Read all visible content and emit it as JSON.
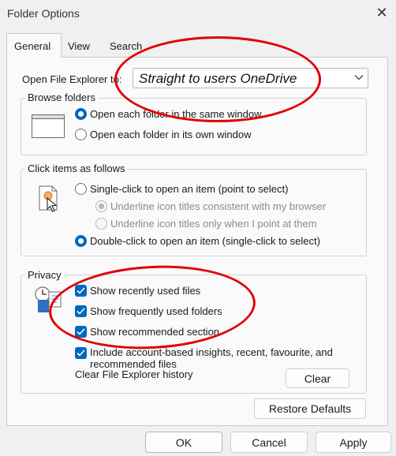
{
  "window": {
    "title": "Folder Options",
    "close_icon": "close-icon"
  },
  "tabs": [
    {
      "label": "General",
      "selected": true
    },
    {
      "label": "View",
      "selected": false
    },
    {
      "label": "Search",
      "selected": false
    }
  ],
  "open_file_explorer": {
    "label": "Open File Explorer to:",
    "value": "Straight to users OneDrive"
  },
  "browse_folders": {
    "legend": "Browse folders",
    "icon": "window-icon",
    "options": [
      {
        "label": "Open each folder in the same window",
        "selected": true
      },
      {
        "label": "Open each folder in its own window",
        "selected": false
      }
    ]
  },
  "click_items": {
    "legend": "Click items as follows",
    "icon": "pointer-file-icon",
    "single_click": {
      "label": "Single-click to open an item (point to select)",
      "selected": false
    },
    "underline_consistent": {
      "label": "Underline icon titles consistent with my browser",
      "enabled": false
    },
    "underline_point": {
      "label": "Underline icon titles only when I point at them",
      "enabled": false
    },
    "double_click": {
      "label": "Double-click to open an item (single-click to select)",
      "selected": true
    }
  },
  "privacy": {
    "legend": "Privacy",
    "icon": "history-documents-icon",
    "checks": [
      {
        "label": "Show recently used files",
        "checked": true
      },
      {
        "label": "Show frequently used folders",
        "checked": true
      },
      {
        "label": "Show recommended section",
        "checked": true
      },
      {
        "label": "Include account-based insights, recent, favourite, and recommended files",
        "checked": true
      }
    ],
    "clear_history_label": "Clear File Explorer history",
    "clear_button": "Clear"
  },
  "buttons": {
    "restore_defaults": "Restore Defaults",
    "ok": "OK",
    "cancel": "Cancel",
    "apply": "Apply"
  },
  "colors": {
    "accent": "#0067c0",
    "annotation": "#e00000"
  }
}
